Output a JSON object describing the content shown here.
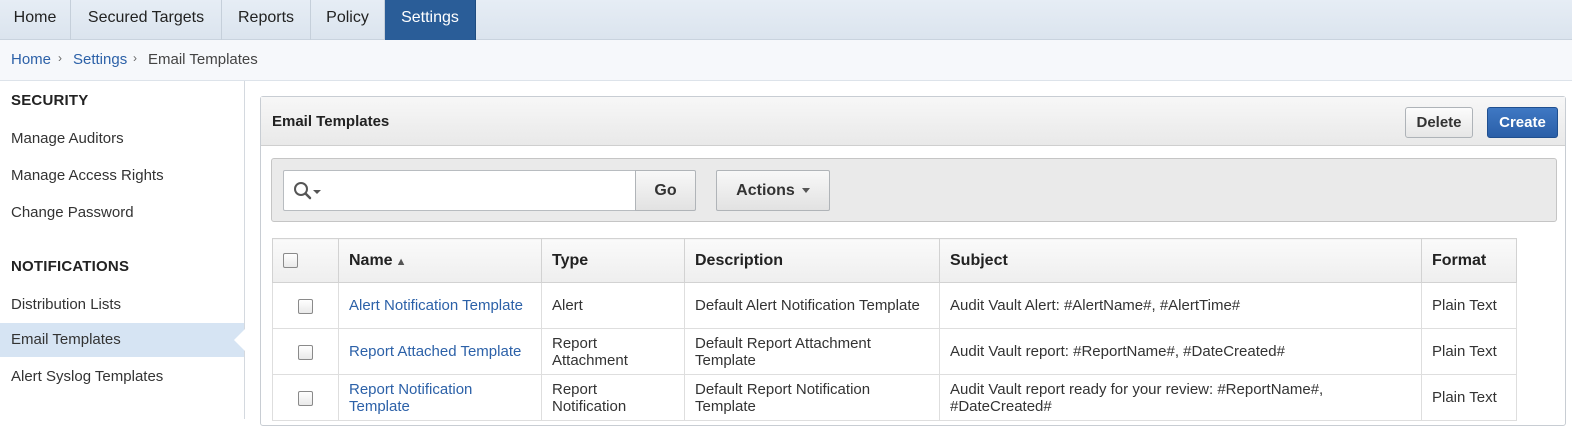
{
  "top_tabs": [
    {
      "label": "Home",
      "active": false
    },
    {
      "label": "Secured Targets",
      "active": false
    },
    {
      "label": "Reports",
      "active": false
    },
    {
      "label": "Policy",
      "active": false
    },
    {
      "label": "Settings",
      "active": true
    }
  ],
  "breadcrumb": {
    "items": [
      "Home",
      "Settings",
      "Email Templates"
    ]
  },
  "sidebar": {
    "sections": [
      {
        "heading": "SECURITY",
        "items": [
          {
            "label": "Manage Auditors"
          },
          {
            "label": "Manage Access Rights"
          },
          {
            "label": "Change Password"
          }
        ]
      },
      {
        "heading": "NOTIFICATIONS",
        "items": [
          {
            "label": "Distribution Lists"
          },
          {
            "label": "Email Templates",
            "active": true
          },
          {
            "label": "Alert Syslog Templates"
          }
        ]
      }
    ]
  },
  "region": {
    "title": "Email Templates",
    "delete_label": "Delete",
    "create_label": "Create"
  },
  "toolbar": {
    "search_value": "",
    "go_label": "Go",
    "actions_label": "Actions"
  },
  "table": {
    "columns": [
      "Name",
      "Type",
      "Description",
      "Subject",
      "Format"
    ],
    "sort_column": "Name",
    "sort_direction": "ascending",
    "rows": [
      {
        "name": "Alert Notification Template",
        "type": "Alert",
        "description": "Default Alert Notification Template",
        "subject": "Audit Vault Alert: #AlertName#, #AlertTime#",
        "format": "Plain Text"
      },
      {
        "name": "Report Attached Template",
        "type": "Report Attachment",
        "description": "Default Report Attachment Template",
        "subject": "Audit Vault report: #ReportName#, #DateCreated#",
        "format": "Plain Text"
      },
      {
        "name": "Report Notification Template",
        "type": "Report Notification",
        "description": "Default Report Notification Template",
        "subject": "Audit Vault report ready for your review: #ReportName#, #DateCreated#",
        "format": "Plain Text"
      }
    ]
  },
  "colors": {
    "active_tab": "#2a5d98",
    "link": "#2c61a8",
    "active_sidebar": "#d6e4f3",
    "create_button": "#2a5fa8"
  }
}
